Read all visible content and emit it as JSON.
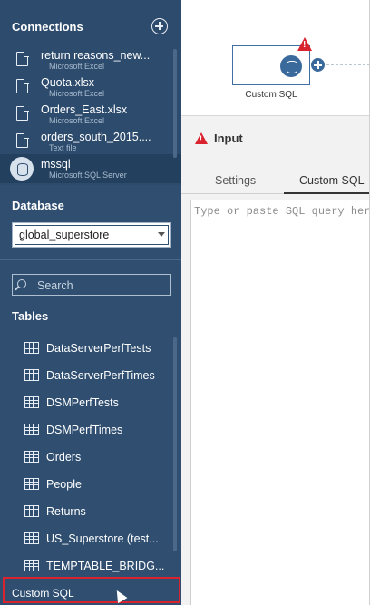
{
  "connections": {
    "header": "Connections",
    "items": [
      {
        "name": "return reasons_new...",
        "type": "Microsoft Excel",
        "icon": "file-icon"
      },
      {
        "name": "Quota.xlsx",
        "type": "Microsoft Excel",
        "icon": "file-icon"
      },
      {
        "name": "Orders_East.xlsx",
        "type": "Microsoft Excel",
        "icon": "file-icon"
      },
      {
        "name": "orders_south_2015....",
        "type": "Text file",
        "icon": "file-icon"
      },
      {
        "name": "mssql",
        "type": "Microsoft SQL Server",
        "icon": "database-icon",
        "selected": true
      }
    ]
  },
  "database": {
    "label": "Database",
    "selected": "global_superstore"
  },
  "search": {
    "placeholder": "Search"
  },
  "tables": {
    "label": "Tables",
    "items": [
      "DataServerPerfTests",
      "DataServerPerfTimes",
      "DSMPerfTests",
      "DSMPerfTimes",
      "Orders",
      "People",
      "Returns",
      "US_Superstore (test...",
      "TEMPTABLE_BRIDG..."
    ]
  },
  "custom_sql": {
    "label": "Custom SQL"
  },
  "flow": {
    "node_label": "Custom SQL"
  },
  "input_panel": {
    "title": "Input",
    "tabs": [
      "Settings",
      "Custom SQL"
    ],
    "active_tab": "Custom SQL",
    "sql_placeholder": "Type or paste SQL query here"
  },
  "colors": {
    "sidebar": "#2f4e70",
    "accent": "#3a6a9b",
    "warning": "#d9232e"
  }
}
